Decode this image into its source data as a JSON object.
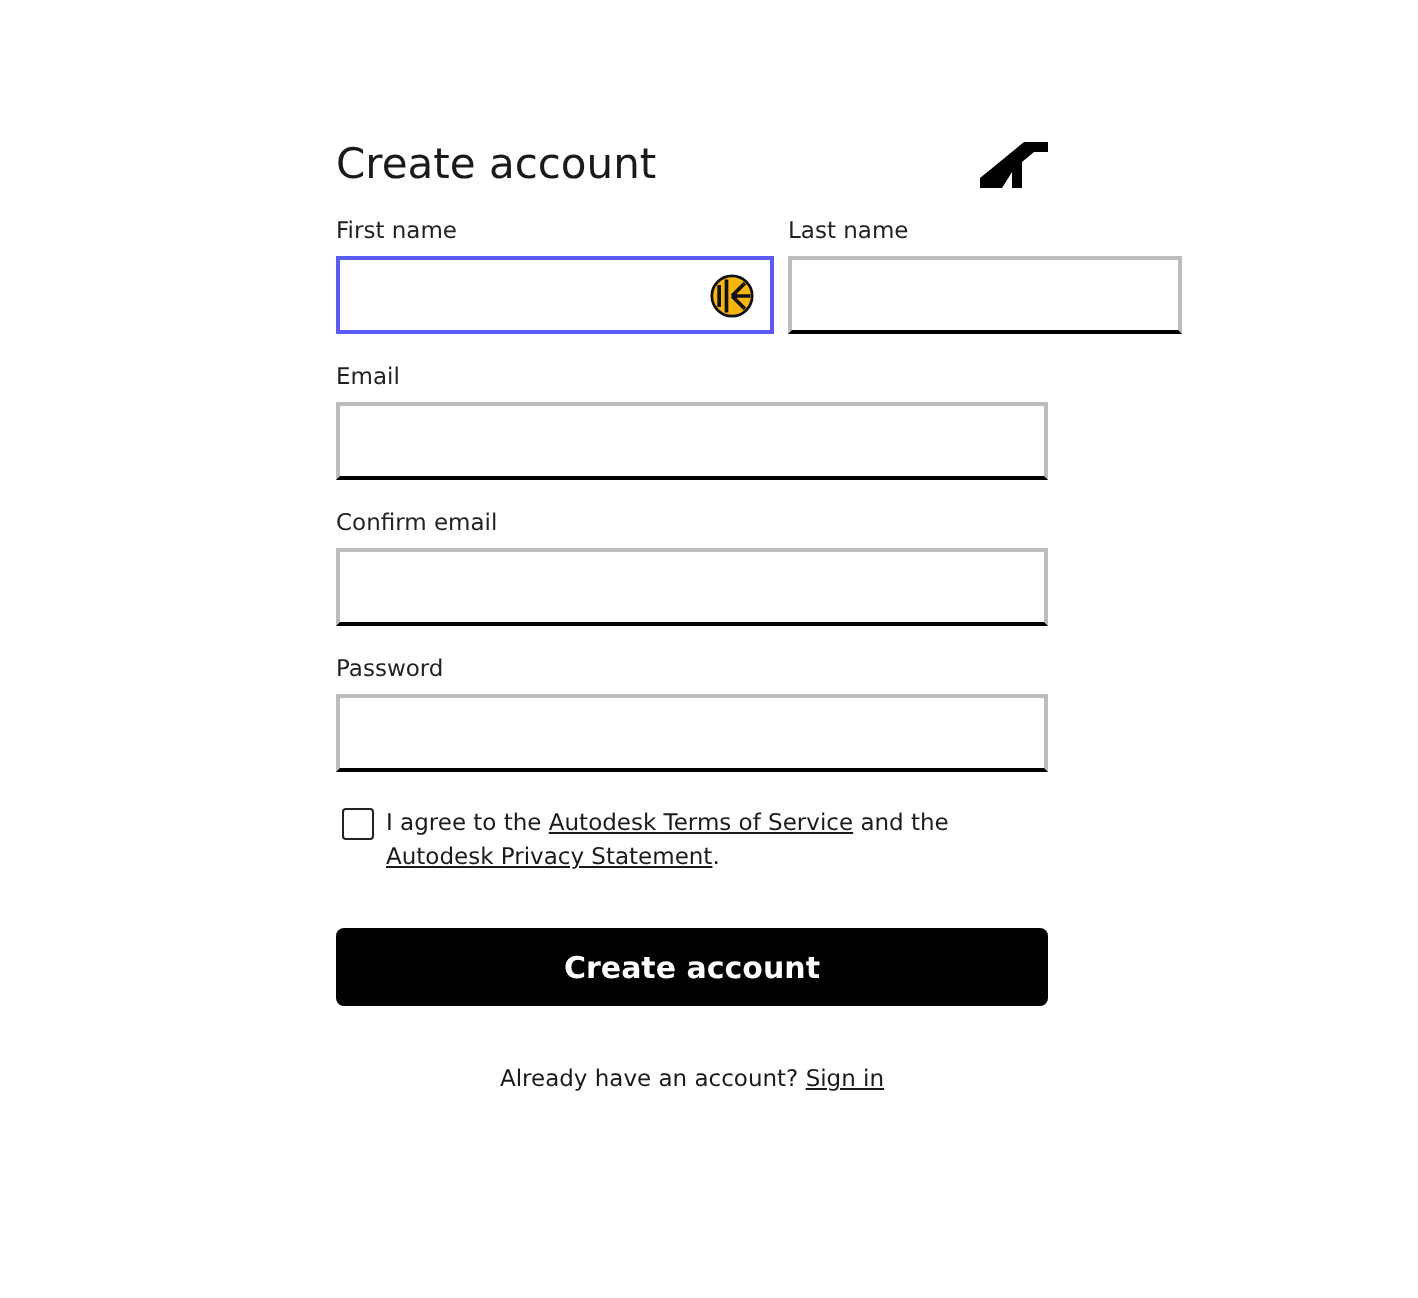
{
  "title": "Create account",
  "name_fields": [
    {
      "label": "First name",
      "focused": true,
      "autofill_icon": true
    },
    {
      "label": "Last name",
      "focused": false,
      "autofill_icon": false
    }
  ],
  "fields": [
    {
      "label": "Email",
      "focused": false
    },
    {
      "label": "Confirm email",
      "focused": false
    },
    {
      "label": "Password",
      "focused": false
    }
  ],
  "agreement": {
    "checked": false,
    "parts": [
      {
        "kind": "text",
        "text": "I agree to the "
      },
      {
        "kind": "link",
        "text": "Autodesk Terms of Service"
      },
      {
        "kind": "text",
        "text": " and the "
      },
      {
        "kind": "link",
        "text": "Autodesk Privacy Statement"
      },
      {
        "kind": "text",
        "text": "."
      }
    ]
  },
  "submit": "Create account",
  "signin": {
    "prompt": "Already have an account? ",
    "link": "Sign in"
  }
}
